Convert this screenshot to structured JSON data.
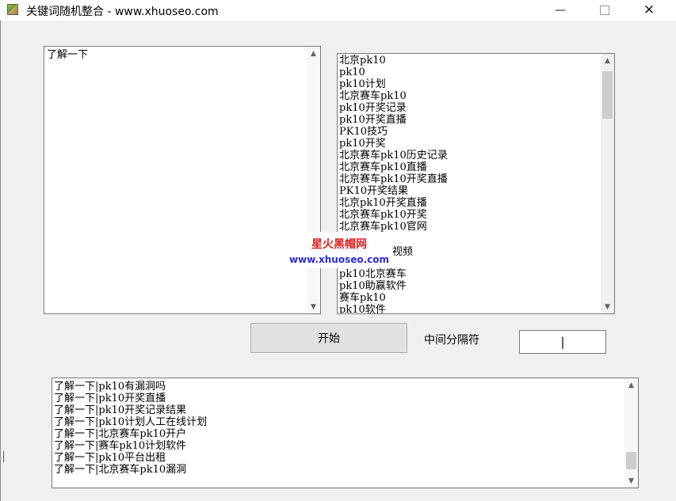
{
  "window": {
    "title": "关键词随机整合 - www.xhuoseo.com",
    "min_glyph": "—",
    "close_glyph": "✕"
  },
  "left_input": {
    "text": "了解一下"
  },
  "keyword_list": {
    "lines": [
      "北京pk10",
      "pk10",
      "pk10计划",
      "北京赛车pk10",
      "pk10开奖记录",
      "pk10开奖直播",
      "PK10技巧",
      "pk10开奖",
      "北京赛车pk10历史记录",
      "北京赛车pk10直播",
      "北京赛车pk10开奖直播",
      "PK10开奖结果",
      "北京pk10开奖直播",
      "北京赛车pk10开奖",
      "北京赛车pk10官网",
      "",
      "",
      "",
      "pk10北京赛车",
      "pk10助赢软件",
      "赛车pk10",
      "pk10软件"
    ]
  },
  "watermark": {
    "title": "星火黑帽网",
    "url": "www.xhuoseo.com",
    "tail": "视频"
  },
  "controls": {
    "start_label": "开始",
    "separator_label": "中间分隔符",
    "separator_value": "|"
  },
  "result_list": {
    "lines": [
      "了解一下|pk10有漏洞吗",
      "了解一下|pk10开奖直播",
      "了解一下|pk10开奖记录结果",
      "了解一下|pk10计划人工在线计划",
      "了解一下|北京赛车pk10开户",
      "了解一下|赛车pk10计划软件",
      "了解一下|pk10平台出租",
      "了解一下|北京赛车pk10漏洞"
    ]
  },
  "icons": {
    "app": "app-icon",
    "scroll_up": "scroll-up-arrow-icon",
    "scroll_down": "scroll-down-arrow-icon"
  }
}
